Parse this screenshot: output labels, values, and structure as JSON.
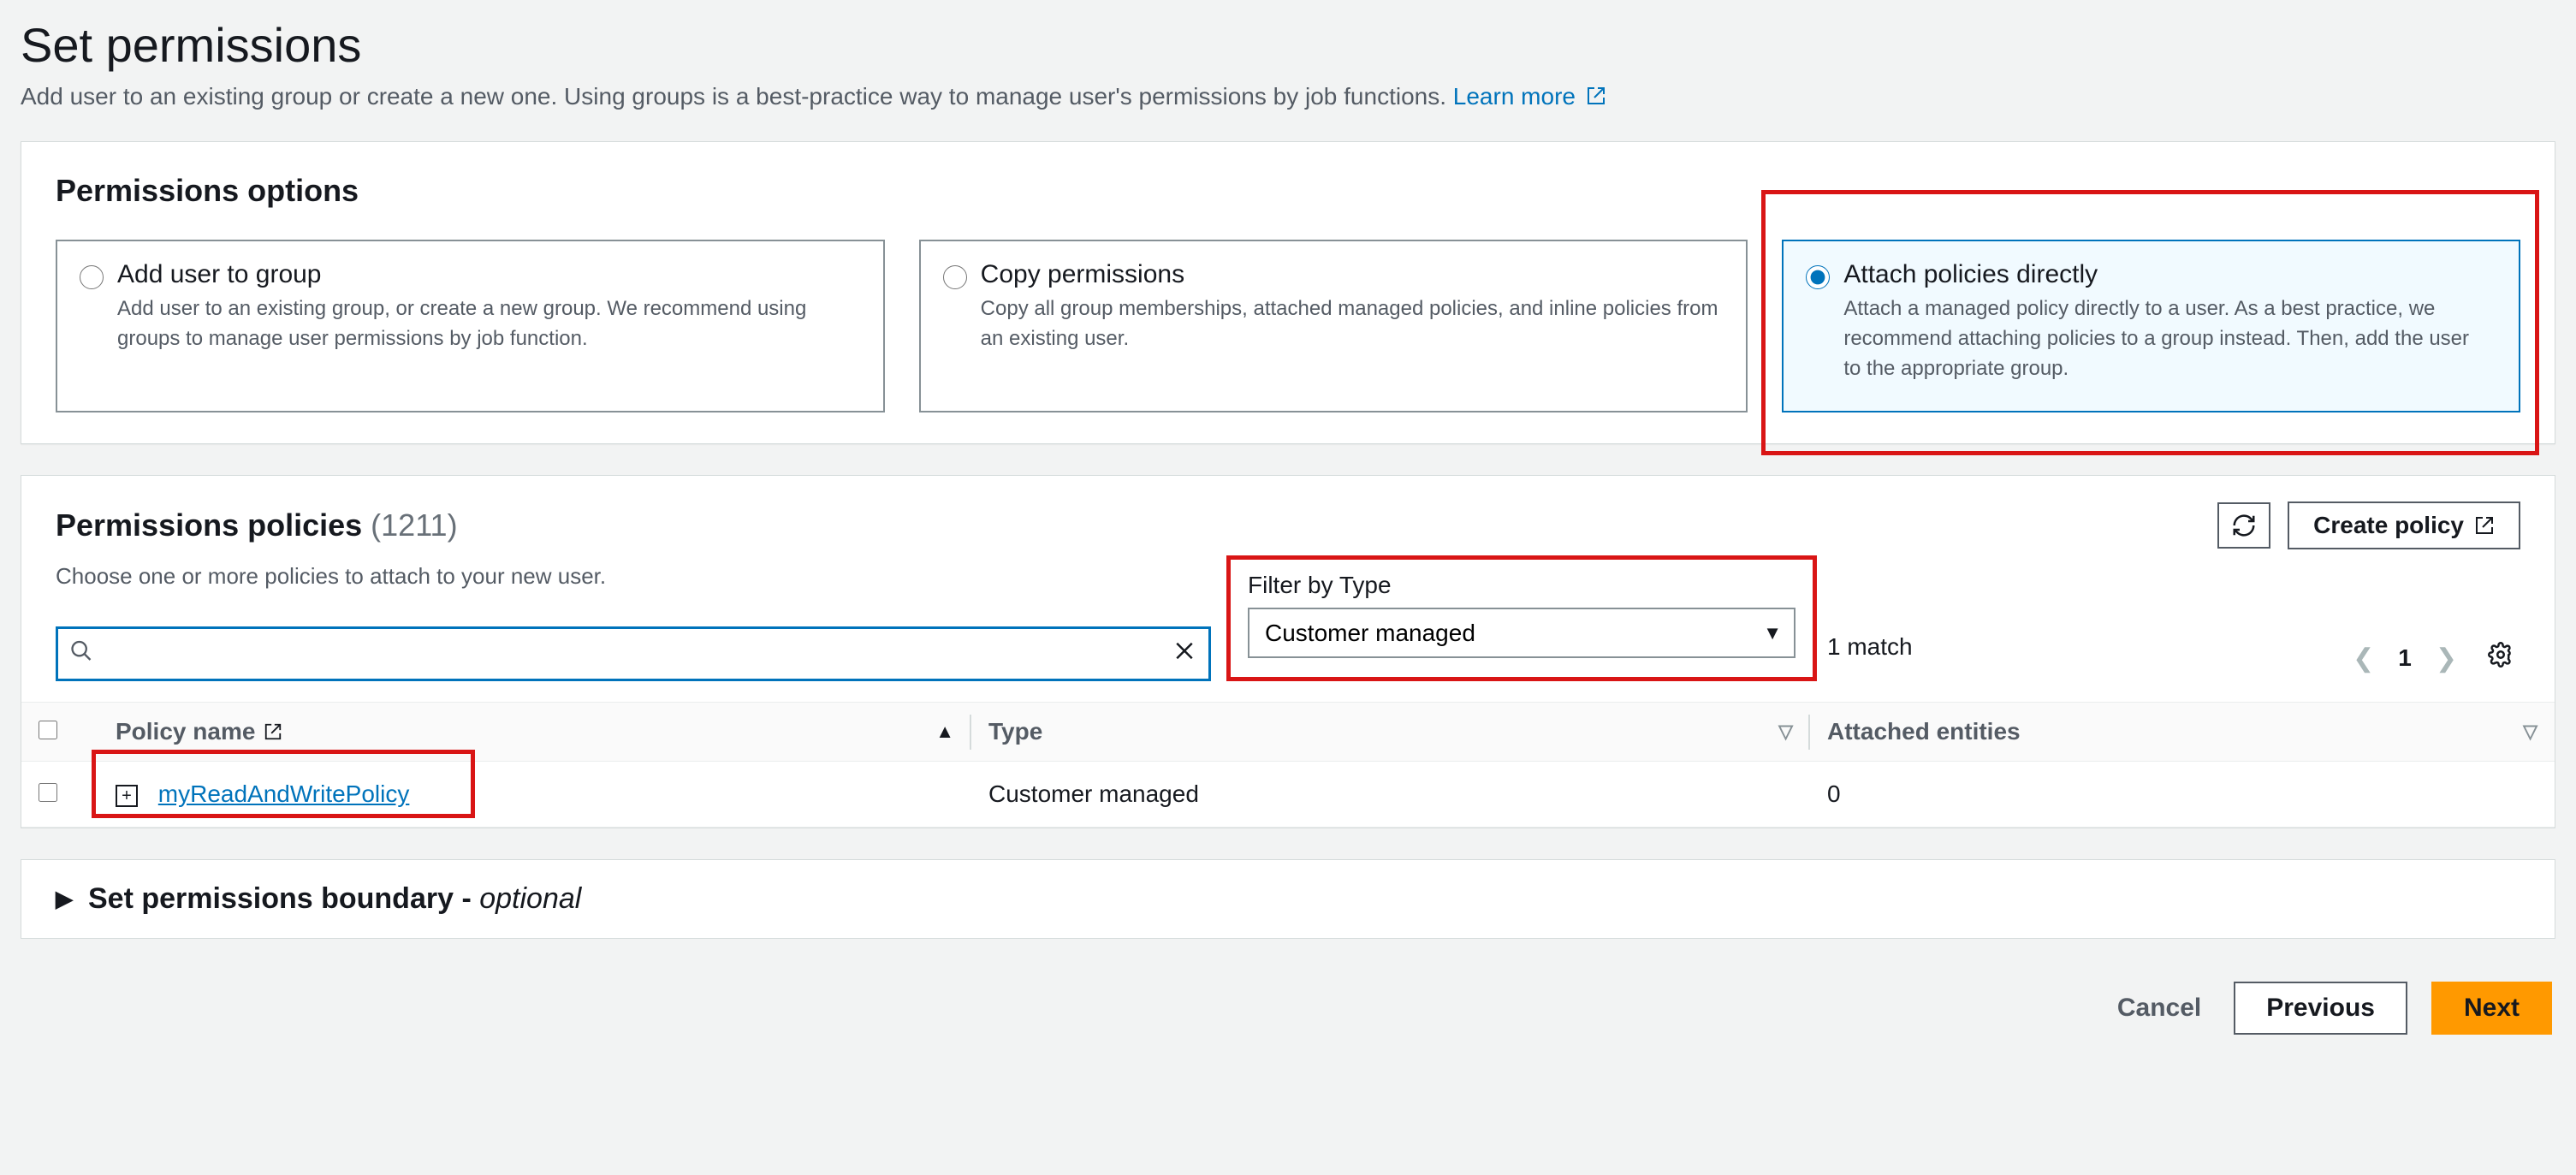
{
  "page": {
    "title": "Set permissions",
    "description": "Add user to an existing group or create a new one. Using groups is a best-practice way to manage user's permissions by job functions. ",
    "learn_more": "Learn more"
  },
  "options_panel": {
    "heading": "Permissions options",
    "cards": [
      {
        "title": "Add user to group",
        "desc": "Add user to an existing group, or create a new group. We recommend using groups to manage user permissions by job function.",
        "selected": false
      },
      {
        "title": "Copy permissions",
        "desc": "Copy all group memberships, attached managed policies, and inline policies from an existing user.",
        "selected": false
      },
      {
        "title": "Attach policies directly",
        "desc": "Attach a managed policy directly to a user. As a best practice, we recommend attaching policies to a group instead. Then, add the user to the appropriate group.",
        "selected": true
      }
    ]
  },
  "policies_panel": {
    "heading": "Permissions policies",
    "count_display": "(1211)",
    "subheading": "Choose one or more policies to attach to your new user.",
    "refresh_label": "Refresh",
    "create_policy_label": "Create policy",
    "search_placeholder": "",
    "filter_label": "Filter by Type",
    "filter_value": "Customer managed",
    "match_text": "1 match",
    "page_number": "1",
    "columns": {
      "name": "Policy name",
      "type": "Type",
      "attached": "Attached entities"
    },
    "rows": [
      {
        "name": "myReadAndWritePolicy",
        "type": "Customer managed",
        "attached": "0",
        "checked": false
      }
    ]
  },
  "boundary_panel": {
    "label": "Set permissions boundary - ",
    "optional": "optional"
  },
  "footer": {
    "cancel": "Cancel",
    "previous": "Previous",
    "next": "Next"
  }
}
